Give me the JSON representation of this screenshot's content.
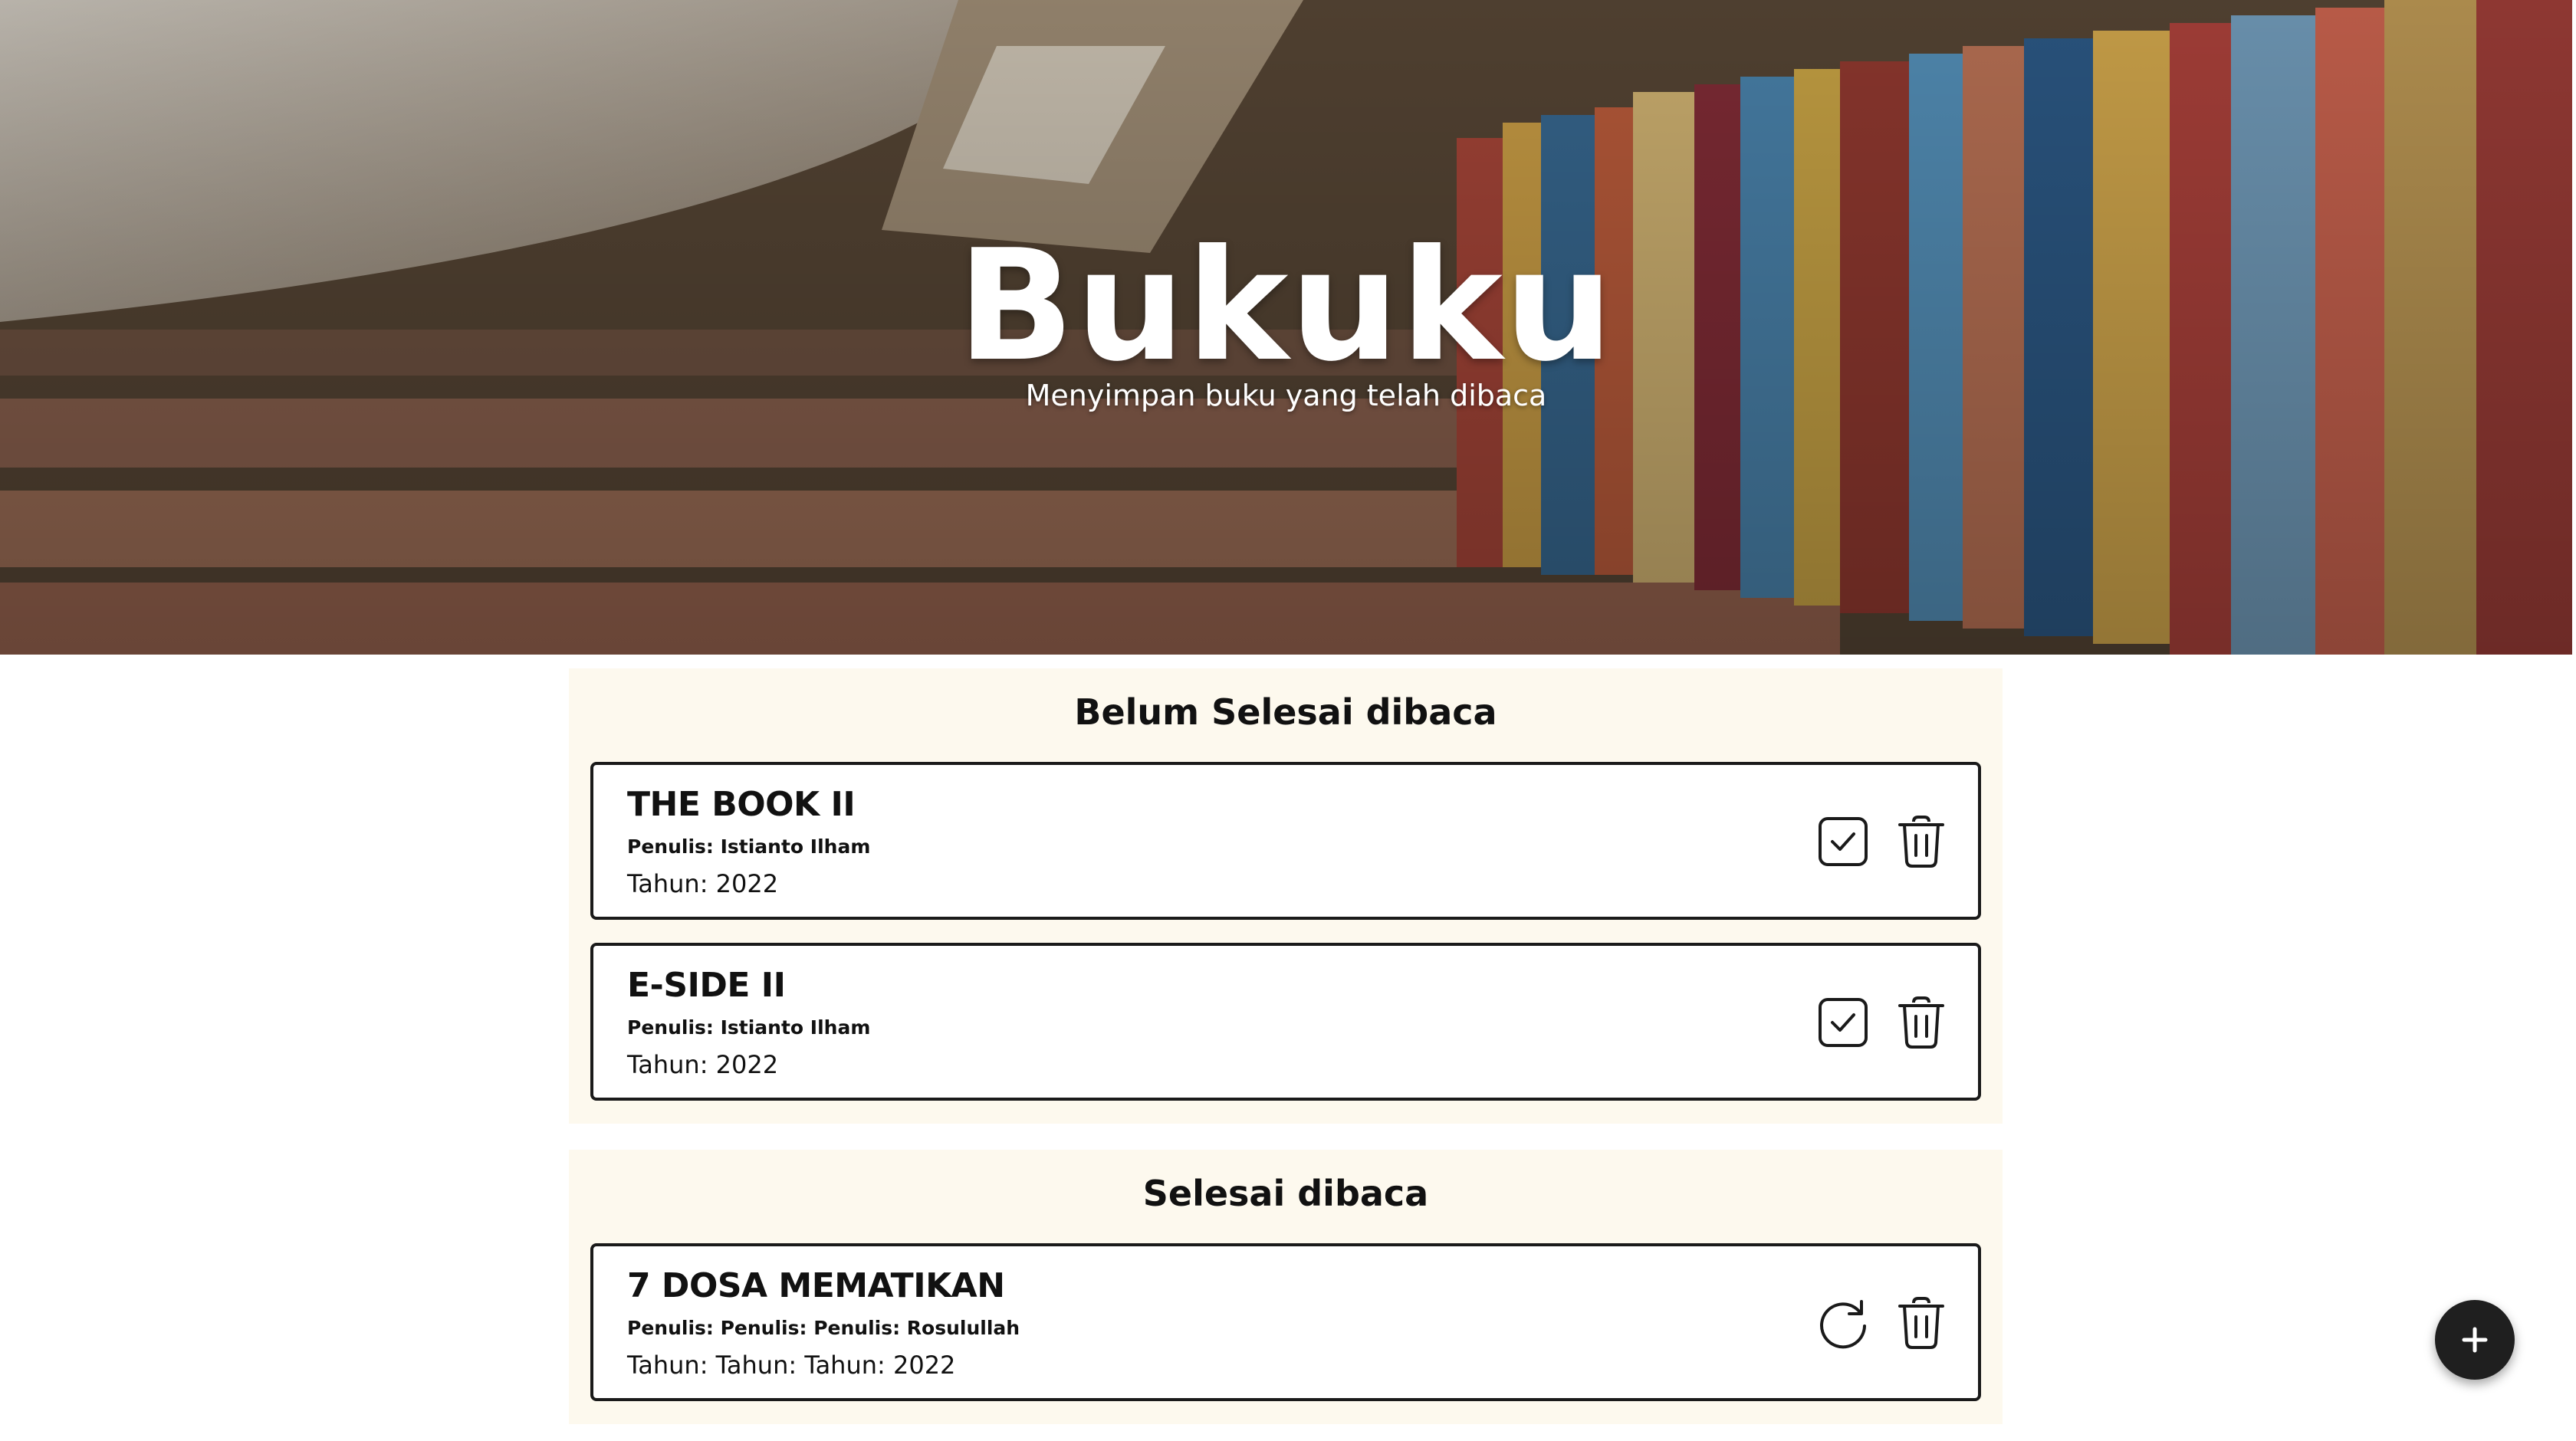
{
  "hero": {
    "title": "Bukuku",
    "subtitle": "Menyimpan buku yang telah dibaca"
  },
  "unread": {
    "heading": "Belum Selesai dibaca",
    "books": [
      {
        "title": "THE BOOK II",
        "author": "Penulis: Istianto Ilham",
        "year": "Tahun: 2022"
      },
      {
        "title": "E-SIDE II",
        "author": "Penulis: Istianto Ilham",
        "year": "Tahun: 2022"
      }
    ]
  },
  "read": {
    "heading": "Selesai dibaca",
    "books": [
      {
        "title": "7 DOSA MEMATIKAN",
        "author": "Penulis: Penulis: Penulis: Rosulullah",
        "year": "Tahun: Tahun: Tahun: 2022"
      }
    ]
  },
  "icons": {
    "mark_done": "check-square-icon",
    "undo": "refresh-icon",
    "delete": "trash-icon",
    "add": "plus-icon"
  },
  "colors": {
    "section_bg": "#fdf9ee",
    "card_border": "#1a1a1a",
    "fab_bg": "#1f1f1f"
  }
}
